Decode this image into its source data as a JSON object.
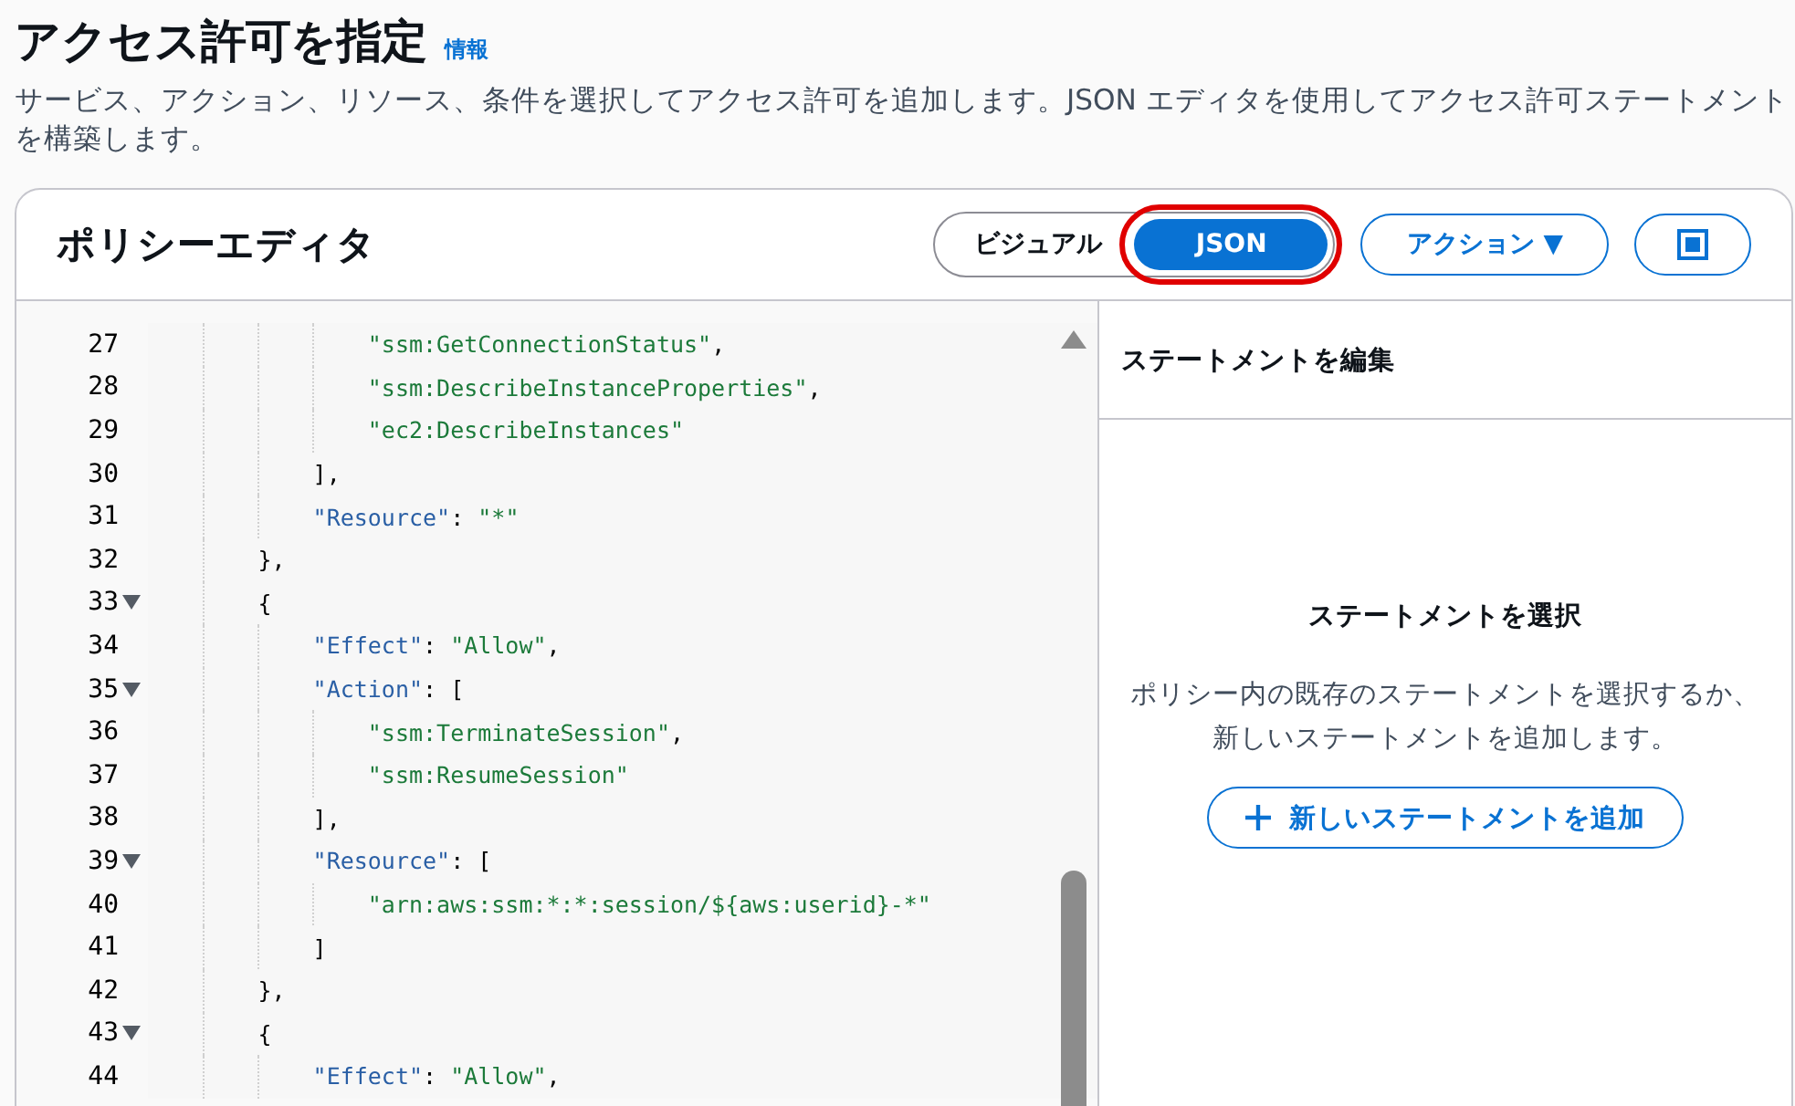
{
  "page": {
    "title": "アクセス許可を指定",
    "info_link": "情報",
    "description": "サービス、アクション、リソース、条件を選択してアクセス許可を追加します。JSON エディタを使用してアクセス許可ステートメントを構築します。"
  },
  "editor_card": {
    "title": "ポリシーエディタ",
    "modes": [
      {
        "label": "ビジュアル",
        "selected": false,
        "highlighted": false
      },
      {
        "label": "JSON",
        "selected": true,
        "highlighted": true
      }
    ],
    "actions_button": "アクション ▼",
    "code_lines": [
      {
        "number": "27",
        "fold": false,
        "tokens": [
          {
            "kind": "string",
            "text": "                \"ssm:GetConnectionStatus\""
          },
          {
            "kind": "punct",
            "text": ","
          }
        ]
      },
      {
        "number": "28",
        "fold": false,
        "tokens": [
          {
            "kind": "string",
            "text": "                \"ssm:DescribeInstanceProperties\""
          },
          {
            "kind": "punct",
            "text": ","
          }
        ]
      },
      {
        "number": "29",
        "fold": false,
        "tokens": [
          {
            "kind": "string",
            "text": "                \"ec2:DescribeInstances\""
          }
        ]
      },
      {
        "number": "30",
        "fold": false,
        "tokens": [
          {
            "kind": "punct",
            "text": "            ],"
          }
        ]
      },
      {
        "number": "31",
        "fold": false,
        "tokens": [
          {
            "kind": "key",
            "text": "            \"Resource\""
          },
          {
            "kind": "punct",
            "text": ": "
          },
          {
            "kind": "string",
            "text": "\"*\""
          }
        ]
      },
      {
        "number": "32",
        "fold": false,
        "tokens": [
          {
            "kind": "punct",
            "text": "        },"
          }
        ]
      },
      {
        "number": "33",
        "fold": true,
        "tokens": [
          {
            "kind": "punct",
            "text": "        {"
          }
        ]
      },
      {
        "number": "34",
        "fold": false,
        "tokens": [
          {
            "kind": "key",
            "text": "            \"Effect\""
          },
          {
            "kind": "punct",
            "text": ": "
          },
          {
            "kind": "string",
            "text": "\"Allow\""
          },
          {
            "kind": "punct",
            "text": ","
          }
        ]
      },
      {
        "number": "35",
        "fold": true,
        "tokens": [
          {
            "kind": "key",
            "text": "            \"Action\""
          },
          {
            "kind": "punct",
            "text": ": ["
          }
        ]
      },
      {
        "number": "36",
        "fold": false,
        "tokens": [
          {
            "kind": "string",
            "text": "                \"ssm:TerminateSession\""
          },
          {
            "kind": "punct",
            "text": ","
          }
        ]
      },
      {
        "number": "37",
        "fold": false,
        "tokens": [
          {
            "kind": "string",
            "text": "                \"ssm:ResumeSession\""
          }
        ]
      },
      {
        "number": "38",
        "fold": false,
        "tokens": [
          {
            "kind": "punct",
            "text": "            ],"
          }
        ]
      },
      {
        "number": "39",
        "fold": true,
        "tokens": [
          {
            "kind": "key",
            "text": "            \"Resource\""
          },
          {
            "kind": "punct",
            "text": ": ["
          }
        ]
      },
      {
        "number": "40",
        "fold": false,
        "tokens": [
          {
            "kind": "string",
            "text": "                \"arn:aws:ssm:*:*:session/${aws:userid}-*\""
          }
        ]
      },
      {
        "number": "41",
        "fold": false,
        "tokens": [
          {
            "kind": "punct",
            "text": "            ]"
          }
        ]
      },
      {
        "number": "42",
        "fold": false,
        "tokens": [
          {
            "kind": "punct",
            "text": "        },"
          }
        ]
      },
      {
        "number": "43",
        "fold": true,
        "tokens": [
          {
            "kind": "punct",
            "text": "        {"
          }
        ]
      },
      {
        "number": "44",
        "fold": false,
        "tokens": [
          {
            "kind": "key",
            "text": "            \"Effect\""
          },
          {
            "kind": "punct",
            "text": ": "
          },
          {
            "kind": "string",
            "text": "\"Allow\""
          },
          {
            "kind": "punct",
            "text": ","
          }
        ]
      }
    ],
    "side_panel": {
      "title": "ステートメントを編集",
      "empty_title": "ステートメントを選択",
      "empty_text": "ポリシー内の既存のステートメントを選択するか、新しいステートメントを追加します。",
      "add_button": "新しいステートメントを追加"
    }
  }
}
